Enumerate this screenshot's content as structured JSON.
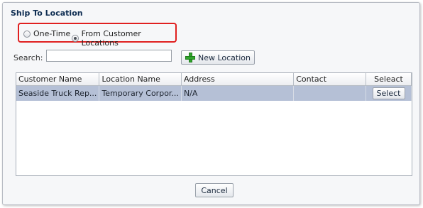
{
  "dialog": {
    "title": "Ship To Location"
  },
  "ship_to": {
    "options": [
      {
        "label": "One-Time",
        "selected": false
      },
      {
        "label": "From Customer Locations",
        "selected": true
      }
    ]
  },
  "search": {
    "label": "Search:",
    "value": "",
    "placeholder": ""
  },
  "new_location": {
    "label": "New Location",
    "icon": "plus-icon",
    "icon_color": "#2fa52b"
  },
  "table": {
    "columns": [
      "Customer Name",
      "Location Name",
      "Address",
      "Contact",
      "Seleact"
    ],
    "rows": [
      {
        "customer_name": "Seaside Truck Rep...",
        "location_name": "Temporary Corpor...",
        "address": "N/A",
        "contact": "",
        "select_label": "Select"
      }
    ],
    "selected_row_color": "#b5c0d6"
  },
  "footer": {
    "cancel_label": "Cancel"
  },
  "highlight_color": "#e02020"
}
